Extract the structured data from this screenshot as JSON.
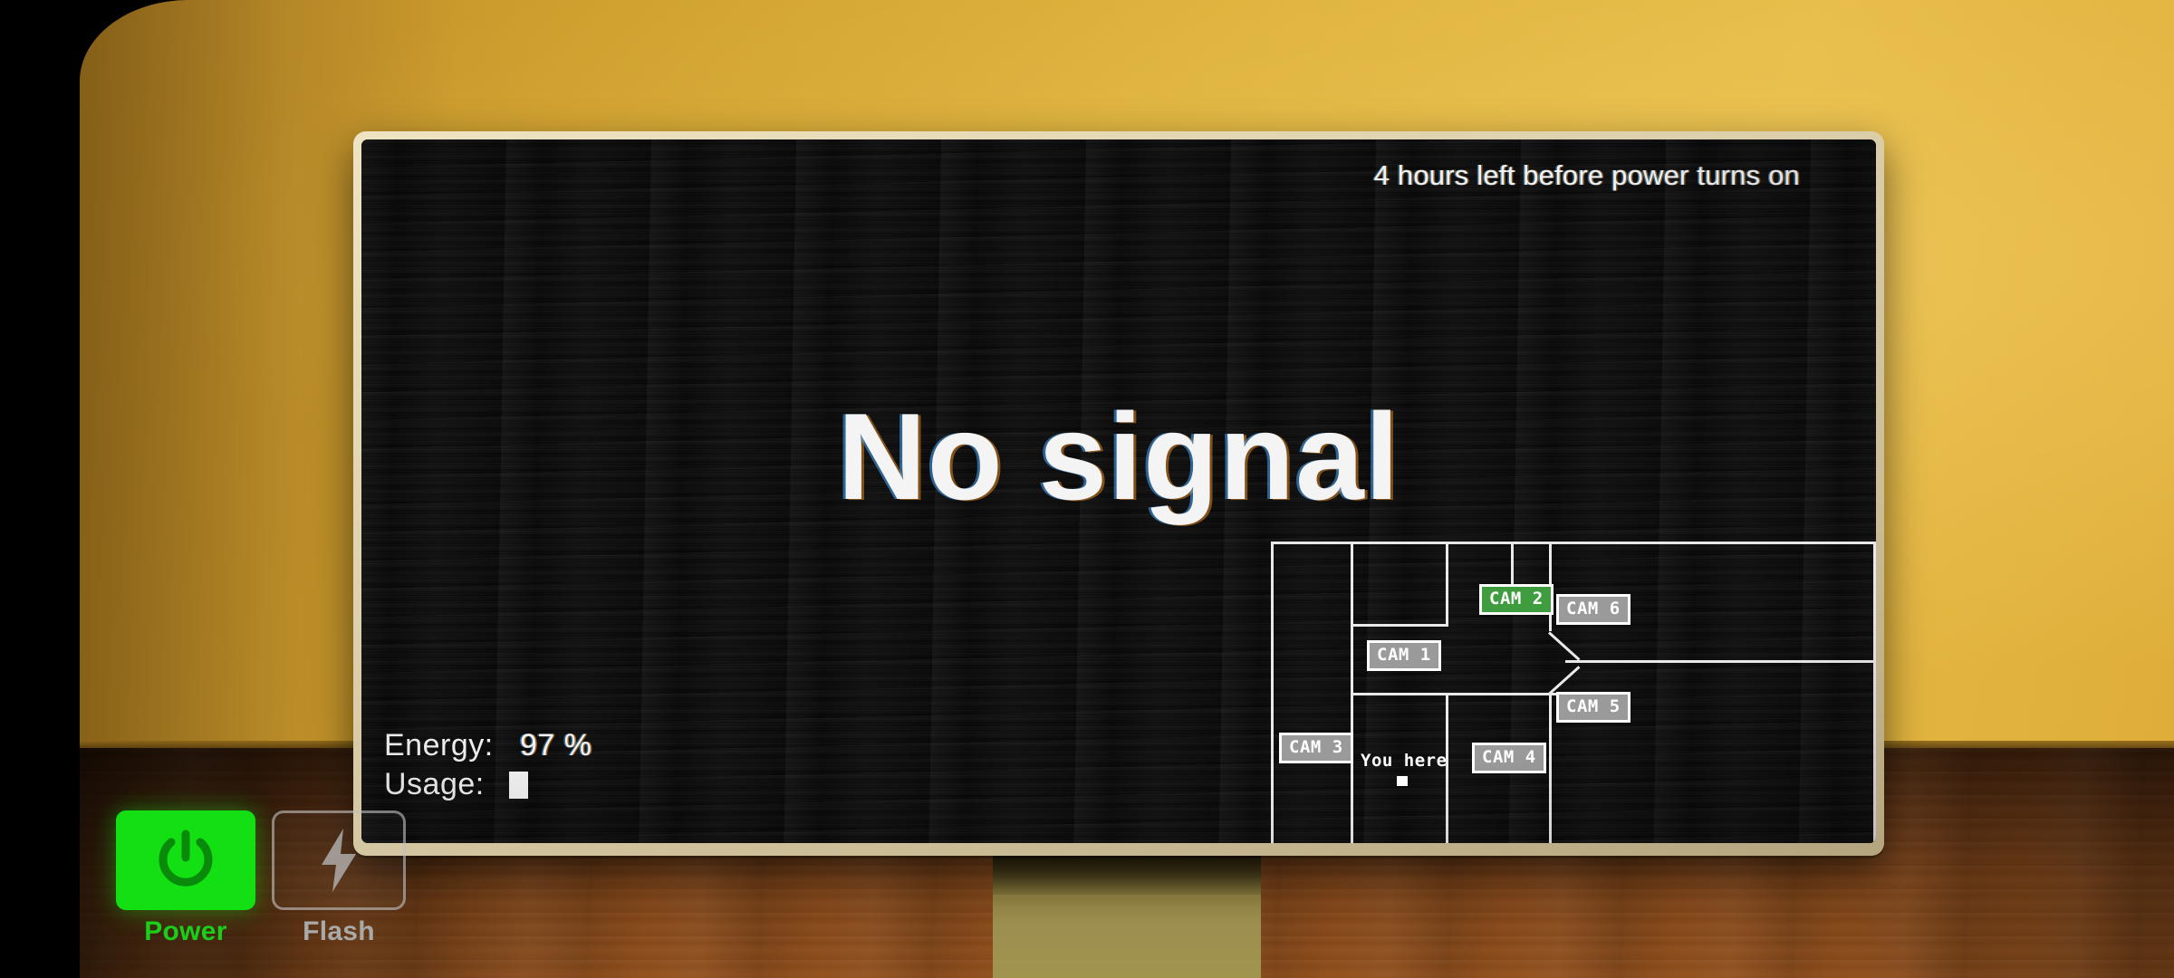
{
  "screen": {
    "hours_left_text": "4 hours left before power turns on",
    "no_signal_text": "No signal",
    "energy_label": "Energy:",
    "energy_value": "97 %",
    "usage_label": "Usage:",
    "usage_bars": 1
  },
  "map": {
    "you_here_label": "You here",
    "cameras": [
      {
        "id": "cam1",
        "label": "CAM 1",
        "active": false
      },
      {
        "id": "cam2",
        "label": "CAM 2",
        "active": true
      },
      {
        "id": "cam3",
        "label": "CAM 3",
        "active": false
      },
      {
        "id": "cam4",
        "label": "CAM 4",
        "active": false
      },
      {
        "id": "cam5",
        "label": "CAM 5",
        "active": false
      },
      {
        "id": "cam6",
        "label": "CAM 6",
        "active": false
      }
    ]
  },
  "controls": {
    "power_label": "Power",
    "flash_label": "Flash",
    "power_icon": "power-icon",
    "flash_icon": "lightning-bolt-icon"
  },
  "colors": {
    "wall": "#dcaf38",
    "floor": "#7e4418",
    "bezel": "#ddd0ac",
    "screen": "#0a0a0a",
    "power_green": "#12e012",
    "cam_active_green": "#3f9c3f",
    "cam_inactive_gray": "#9a9a9a",
    "text_white": "#ffffff",
    "flash_gray": "#a9a9a9"
  }
}
